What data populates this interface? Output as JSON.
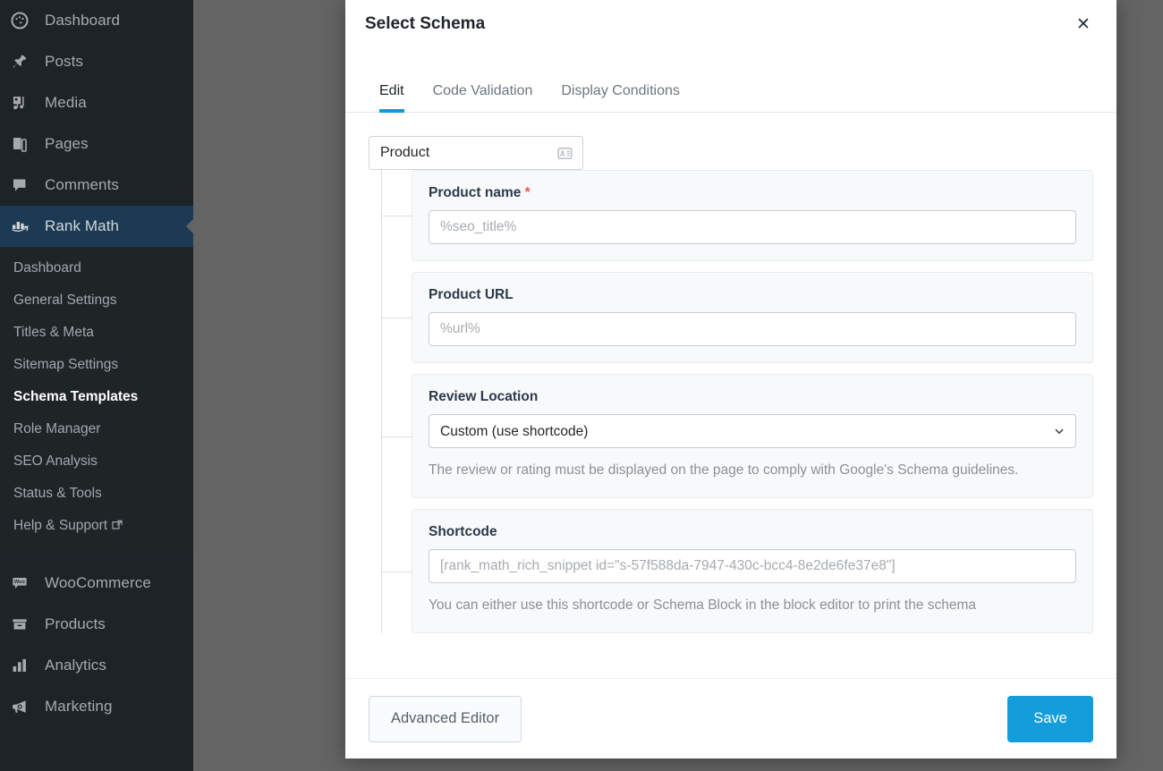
{
  "colors": {
    "sidebar_bg": "#1d2327",
    "sidebar_submenu_bg": "#1f2427",
    "sidebar_active_bg": "#1d3a54",
    "overlay": "#646464",
    "accent_blue": "#0d9bd6",
    "primary_button": "#139ddb",
    "required_star": "#e8604c"
  },
  "sidebar": {
    "items": [
      {
        "label": "Dashboard",
        "icon": "dashboard-icon",
        "active": false
      },
      {
        "label": "Posts",
        "icon": "pin-icon",
        "active": false
      },
      {
        "label": "Media",
        "icon": "media-icon",
        "active": false
      },
      {
        "label": "Pages",
        "icon": "pages-icon",
        "active": false
      },
      {
        "label": "Comments",
        "icon": "comments-icon",
        "active": false
      },
      {
        "label": "Rank Math",
        "icon": "rank-math-icon",
        "active": true
      }
    ],
    "submenu": [
      {
        "label": "Dashboard",
        "current": false,
        "external": false
      },
      {
        "label": "General Settings",
        "current": false,
        "external": false
      },
      {
        "label": "Titles & Meta",
        "current": false,
        "external": false
      },
      {
        "label": "Sitemap Settings",
        "current": false,
        "external": false
      },
      {
        "label": "Schema Templates",
        "current": true,
        "external": false
      },
      {
        "label": "Role Manager",
        "current": false,
        "external": false
      },
      {
        "label": "SEO Analysis",
        "current": false,
        "external": false
      },
      {
        "label": "Status & Tools",
        "current": false,
        "external": false
      },
      {
        "label": "Help & Support",
        "current": false,
        "external": true
      }
    ],
    "items_bottom": [
      {
        "label": "WooCommerce",
        "icon": "woocommerce-icon"
      },
      {
        "label": "Products",
        "icon": "products-icon"
      },
      {
        "label": "Analytics",
        "icon": "analytics-icon"
      },
      {
        "label": "Marketing",
        "icon": "marketing-icon"
      }
    ]
  },
  "modal": {
    "title": "Select Schema",
    "close_label": "✕",
    "tabs": [
      {
        "label": "Edit",
        "active": true
      },
      {
        "label": "Code Validation",
        "active": false
      },
      {
        "label": "Display Conditions",
        "active": false
      }
    ],
    "schema_type": {
      "label": "Product",
      "icon": "contact-card-icon"
    },
    "fields": [
      {
        "label": "Product name",
        "required": true,
        "type": "text",
        "value": "",
        "placeholder": "%seo_title%",
        "help": ""
      },
      {
        "label": "Product URL",
        "required": false,
        "type": "text",
        "value": "",
        "placeholder": "%url%",
        "help": ""
      },
      {
        "label": "Review Location",
        "required": false,
        "type": "select",
        "value": "Custom (use shortcode)",
        "options": [
          "Custom (use shortcode)"
        ],
        "help": "The review or rating must be displayed on the page to comply with Google's Schema guidelines."
      },
      {
        "label": "Shortcode",
        "required": false,
        "type": "text",
        "value": "",
        "placeholder": "[rank_math_rich_snippet id=\"s-57f588da-7947-430c-bcc4-8e2de6fe37e8\"]",
        "help": "You can either use this shortcode or Schema Block in the block editor to print the schema"
      }
    ],
    "footer": {
      "advanced_editor_label": "Advanced Editor",
      "save_label": "Save"
    }
  }
}
